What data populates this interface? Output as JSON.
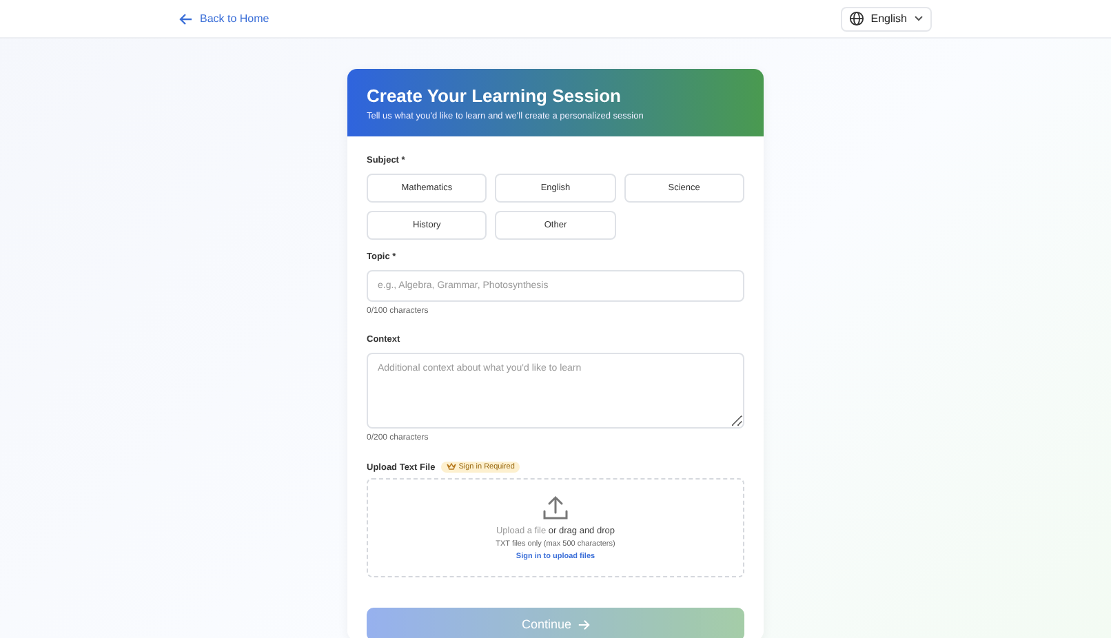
{
  "nav": {
    "back_link": "Back to Home",
    "language": "English"
  },
  "card": {
    "title": "Create Your Learning Session",
    "subtitle": "Tell us what you'd like to learn and we'll create a personalized session"
  },
  "subject": {
    "label": "Subject *",
    "options": [
      {
        "label": "Mathematics",
        "selected": false
      },
      {
        "label": "English",
        "selected": false
      },
      {
        "label": "Science",
        "selected": false
      },
      {
        "label": "History",
        "selected": false
      },
      {
        "label": "Other",
        "selected": false
      }
    ]
  },
  "topic": {
    "label": "Topic *",
    "placeholder": "e.g., Algebra, Grammar, Photosynthesis",
    "counter": "0/100 characters"
  },
  "context": {
    "label": "Context",
    "placeholder": "Additional context about what you'd like to learn",
    "counter": "0/200 characters"
  },
  "upload": {
    "label": "Upload Text File",
    "badge": "Sign in Required",
    "prompt": "**Upload a file** or drag and drop",
    "hint": "TXT files only (max 500 characters)",
    "signin_link": "Sign in to upload files"
  },
  "continue_button": {
    "label": "Continue",
    "disabled": true
  }
}
